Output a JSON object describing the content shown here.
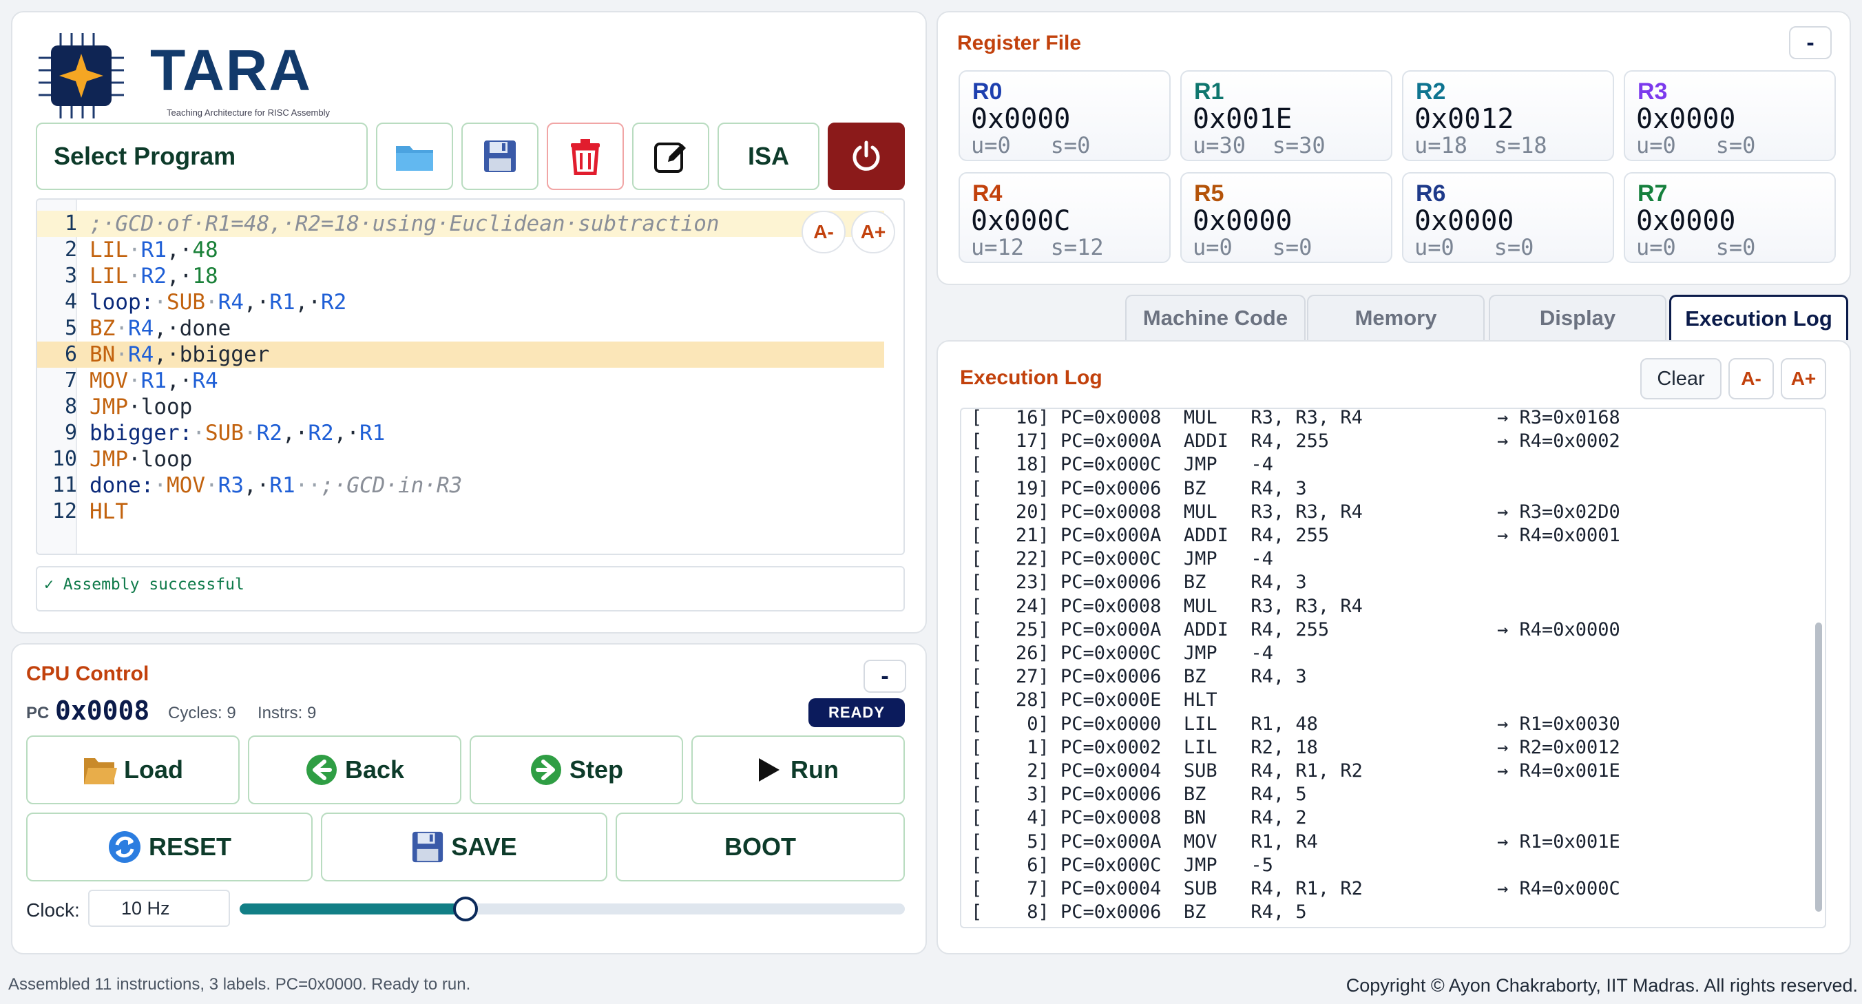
{
  "app": {
    "logo_title": "TARA",
    "logo_subtitle": "Teaching Architecture for RISC Assembly"
  },
  "toolbar": {
    "select_program": "Select Program",
    "isa_label": "ISA"
  },
  "editor": {
    "font_down": "A-",
    "font_up": "A+",
    "lines": [
      [
        {
          "t": ";·GCD·of·R1=48,·R2=18·using·Euclidean·subtraction",
          "c": "cmt"
        }
      ],
      [
        {
          "t": "LIL",
          "c": "kw"
        },
        {
          "t": "·",
          "c": "dot"
        },
        {
          "t": "R1",
          "c": "reg"
        },
        {
          "t": ",·",
          "c": "txt"
        },
        {
          "t": "48",
          "c": "num"
        }
      ],
      [
        {
          "t": "LIL",
          "c": "kw"
        },
        {
          "t": "·",
          "c": "dot"
        },
        {
          "t": "R2",
          "c": "reg"
        },
        {
          "t": ",·",
          "c": "txt"
        },
        {
          "t": "18",
          "c": "num"
        }
      ],
      [
        {
          "t": "loop:",
          "c": "lbl"
        },
        {
          "t": "·",
          "c": "dot"
        },
        {
          "t": "SUB",
          "c": "kw"
        },
        {
          "t": "·",
          "c": "dot"
        },
        {
          "t": "R4",
          "c": "reg"
        },
        {
          "t": ",·",
          "c": "txt"
        },
        {
          "t": "R1",
          "c": "reg"
        },
        {
          "t": ",·",
          "c": "txt"
        },
        {
          "t": "R2",
          "c": "reg"
        }
      ],
      [
        {
          "t": "BZ",
          "c": "kw"
        },
        {
          "t": "·",
          "c": "dot"
        },
        {
          "t": "R4",
          "c": "reg"
        },
        {
          "t": ",·done",
          "c": "txt"
        }
      ],
      [
        {
          "t": "BN",
          "c": "kw"
        },
        {
          "t": "·",
          "c": "dot"
        },
        {
          "t": "R4",
          "c": "reg"
        },
        {
          "t": ",·bbigger",
          "c": "txt"
        }
      ],
      [
        {
          "t": "MOV",
          "c": "kw"
        },
        {
          "t": "·",
          "c": "dot"
        },
        {
          "t": "R1",
          "c": "reg"
        },
        {
          "t": ",·",
          "c": "txt"
        },
        {
          "t": "R4",
          "c": "reg"
        }
      ],
      [
        {
          "t": "JMP",
          "c": "kw"
        },
        {
          "t": "·loop",
          "c": "txt"
        }
      ],
      [
        {
          "t": "bbigger:",
          "c": "lbl"
        },
        {
          "t": "·",
          "c": "dot"
        },
        {
          "t": "SUB",
          "c": "kw"
        },
        {
          "t": "·",
          "c": "dot"
        },
        {
          "t": "R2",
          "c": "reg"
        },
        {
          "t": ",·",
          "c": "txt"
        },
        {
          "t": "R2",
          "c": "reg"
        },
        {
          "t": ",·",
          "c": "txt"
        },
        {
          "t": "R1",
          "c": "reg"
        }
      ],
      [
        {
          "t": "JMP",
          "c": "kw"
        },
        {
          "t": "·loop",
          "c": "txt"
        }
      ],
      [
        {
          "t": "done:",
          "c": "lbl"
        },
        {
          "t": "·",
          "c": "dot"
        },
        {
          "t": "MOV",
          "c": "kw"
        },
        {
          "t": "·",
          "c": "dot"
        },
        {
          "t": "R3",
          "c": "reg"
        },
        {
          "t": ",·",
          "c": "txt"
        },
        {
          "t": "R1",
          "c": "reg"
        },
        {
          "t": "··",
          "c": "dot"
        },
        {
          "t": ";·GCD·in·R3",
          "c": "cmt"
        }
      ],
      [
        {
          "t": "HLT",
          "c": "kw"
        }
      ]
    ],
    "line_numbers": [
      "1",
      "2",
      "3",
      "4",
      "5",
      "6",
      "7",
      "8",
      "9",
      "10",
      "11",
      "12"
    ],
    "status": "✓ Assembly successful"
  },
  "cpu": {
    "title": "CPU Control",
    "collapse": "-",
    "pc_label": "PC",
    "pc_value": "0x0008",
    "cycles": "Cycles: 9",
    "instrs": "Instrs: 9",
    "state": "READY",
    "load": "Load",
    "back": "Back",
    "step": "Step",
    "run": "Run",
    "reset": "RESET",
    "save": "SAVE",
    "boot": "BOOT",
    "clock_label": "Clock:",
    "clock_value": "10 Hz",
    "clock_level_percent": 34
  },
  "registers": {
    "title": "Register File",
    "collapse": "-",
    "items": [
      {
        "name": "R0",
        "hex": "0x0000",
        "us": "u=0   s=0",
        "color": "#1e40af"
      },
      {
        "name": "R1",
        "hex": "0x001E",
        "us": "u=30  s=30",
        "color": "#0f766e"
      },
      {
        "name": "R2",
        "hex": "0x0012",
        "us": "u=18  s=18",
        "color": "#0e7490"
      },
      {
        "name": "R3",
        "hex": "0x0000",
        "us": "u=0   s=0",
        "color": "#7c3aed"
      },
      {
        "name": "R4",
        "hex": "0x000C",
        "us": "u=12  s=12",
        "color": "#c2410c"
      },
      {
        "name": "R5",
        "hex": "0x0000",
        "us": "u=0   s=0",
        "color": "#b45309"
      },
      {
        "name": "R6",
        "hex": "0x0000",
        "us": "u=0   s=0",
        "color": "#1e3a8a"
      },
      {
        "name": "R7",
        "hex": "0x0000",
        "us": "u=0   s=0",
        "color": "#15803d"
      }
    ]
  },
  "tabs": [
    "Machine Code",
    "Memory",
    "Display",
    "Execution Log"
  ],
  "log": {
    "title": "Execution Log",
    "clear": "Clear",
    "font_down": "A-",
    "font_up": "A+",
    "lines": [
      "[   16] PC=0x0008  MUL   R3, R3, R4            → R3=0x0168",
      "[   17] PC=0x000A  ADDI  R4, 255               → R4=0x0002",
      "[   18] PC=0x000C  JMP   -4",
      "[   19] PC=0x0006  BZ    R4, 3",
      "[   20] PC=0x0008  MUL   R3, R3, R4            → R3=0x02D0",
      "[   21] PC=0x000A  ADDI  R4, 255               → R4=0x0001",
      "[   22] PC=0x000C  JMP   -4",
      "[   23] PC=0x0006  BZ    R4, 3",
      "[   24] PC=0x0008  MUL   R3, R3, R4",
      "[   25] PC=0x000A  ADDI  R4, 255               → R4=0x0000",
      "[   26] PC=0x000C  JMP   -4",
      "[   27] PC=0x0006  BZ    R4, 3",
      "[   28] PC=0x000E  HLT",
      "[    0] PC=0x0000  LIL   R1, 48                → R1=0x0030",
      "[    1] PC=0x0002  LIL   R2, 18                → R2=0x0012",
      "[    2] PC=0x0004  SUB   R4, R1, R2            → R4=0x001E",
      "[    3] PC=0x0006  BZ    R4, 5",
      "[    4] PC=0x0008  BN    R4, 2",
      "[    5] PC=0x000A  MOV   R1, R4                → R1=0x001E",
      "[    6] PC=0x000C  JMP   -5",
      "[    7] PC=0x0004  SUB   R4, R1, R2            → R4=0x000C",
      "[    8] PC=0x0006  BZ    R4, 5"
    ]
  },
  "footer": {
    "status": "Assembled 11 instructions, 3 labels. PC=0x0000. Ready to run.",
    "copyright": "Copyright © Ayon Chakraborty, IIT Madras. All rights reserved."
  }
}
